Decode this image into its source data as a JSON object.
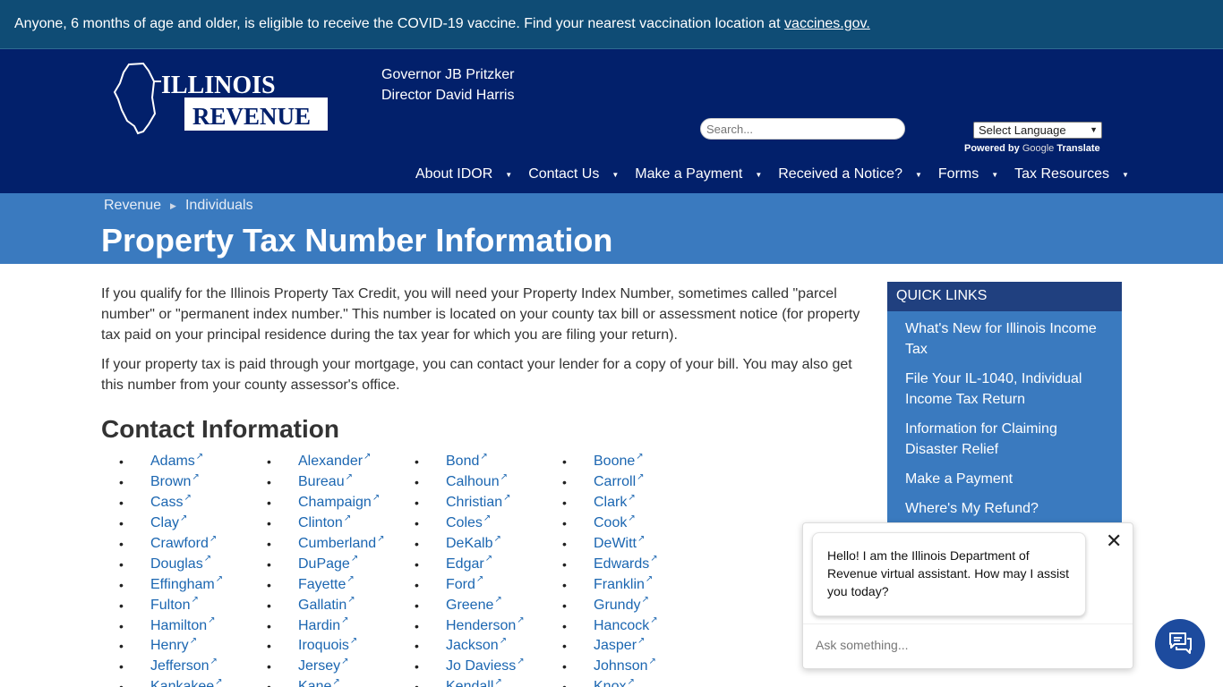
{
  "alert": {
    "text": "Anyone, 6 months of age and older, is eligible to receive the COVID-19 vaccine. Find your nearest vaccination location at ",
    "link": "vaccines.gov."
  },
  "header": {
    "logo_line1": "ILLINOIS",
    "logo_line2": "REVENUE",
    "governor": "Governor JB Pritzker",
    "director": "Director David Harris",
    "search_placeholder": "Search...",
    "language_select": "Select Language",
    "powered_by": "Powered by",
    "google": "Google",
    "translate": "Translate"
  },
  "nav": [
    "About IDOR",
    "Contact Us",
    "Make a Payment",
    "Received a Notice?",
    "Forms",
    "Tax Resources"
  ],
  "breadcrumb": [
    "Revenue",
    "Individuals"
  ],
  "page_title": "Property Tax Number Information",
  "paragraphs": [
    "If you qualify for the Illinois Property Tax Credit, you will need your Property Index Number, sometimes called \"parcel number\" or \"permanent index number.\" This number is located on your county tax bill or assessment notice (for property tax paid on your principal residence during the tax year for which you are filing your return).",
    "If your property tax is paid through your mortgage, you can contact your lender for a copy of your bill. You may also get this number from your county assessor's office."
  ],
  "contact_heading": "Contact Information",
  "counties": [
    [
      "Adams",
      "Brown",
      "Cass",
      "Clay",
      "Crawford",
      "Douglas",
      "Effingham",
      "Fulton",
      "Hamilton",
      "Henry",
      "Jefferson",
      "Kankakee"
    ],
    [
      "Alexander",
      "Bureau",
      "Champaign",
      "Clinton",
      "Cumberland",
      "DuPage",
      "Fayette",
      "Gallatin",
      "Hardin",
      "Iroquois",
      "Jersey",
      "Kane"
    ],
    [
      "Bond",
      "Calhoun",
      "Christian",
      "Coles",
      "DeKalb",
      "Edgar",
      "Ford",
      "Greene",
      "Henderson",
      "Jackson",
      "Jo Daviess",
      "Kendall"
    ],
    [
      "Boone",
      "Carroll",
      "Clark",
      "Cook",
      "DeWitt",
      "Edwards",
      "Franklin",
      "Grundy",
      "Hancock",
      "Jasper",
      "Johnson",
      "Knox"
    ]
  ],
  "quick_links": {
    "title": "QUICK LINKS",
    "items": [
      "What's New for Illinois Income Tax",
      "File Your IL-1040, Individual Income Tax Return",
      "Information for Claiming Disaster Relief",
      "Make a Payment",
      "Where's My Refund?"
    ]
  },
  "chat": {
    "message": "Hello! I am the Illinois Department of Revenue virtual assistant. How may I assist you today?",
    "input_placeholder": "Ask something..."
  },
  "colors": {
    "alert_bg": "#0f4c75",
    "header_bg": "#02206b",
    "banner_bg": "#3a7abf",
    "link": "#1b66b1",
    "quick_links_head": "#20407f",
    "chat_button": "#1d4b9e"
  },
  "icons": [
    "close-icon",
    "chat-icon",
    "external-link-icon",
    "chevron-down-icon",
    "illinois-map-icon"
  ]
}
